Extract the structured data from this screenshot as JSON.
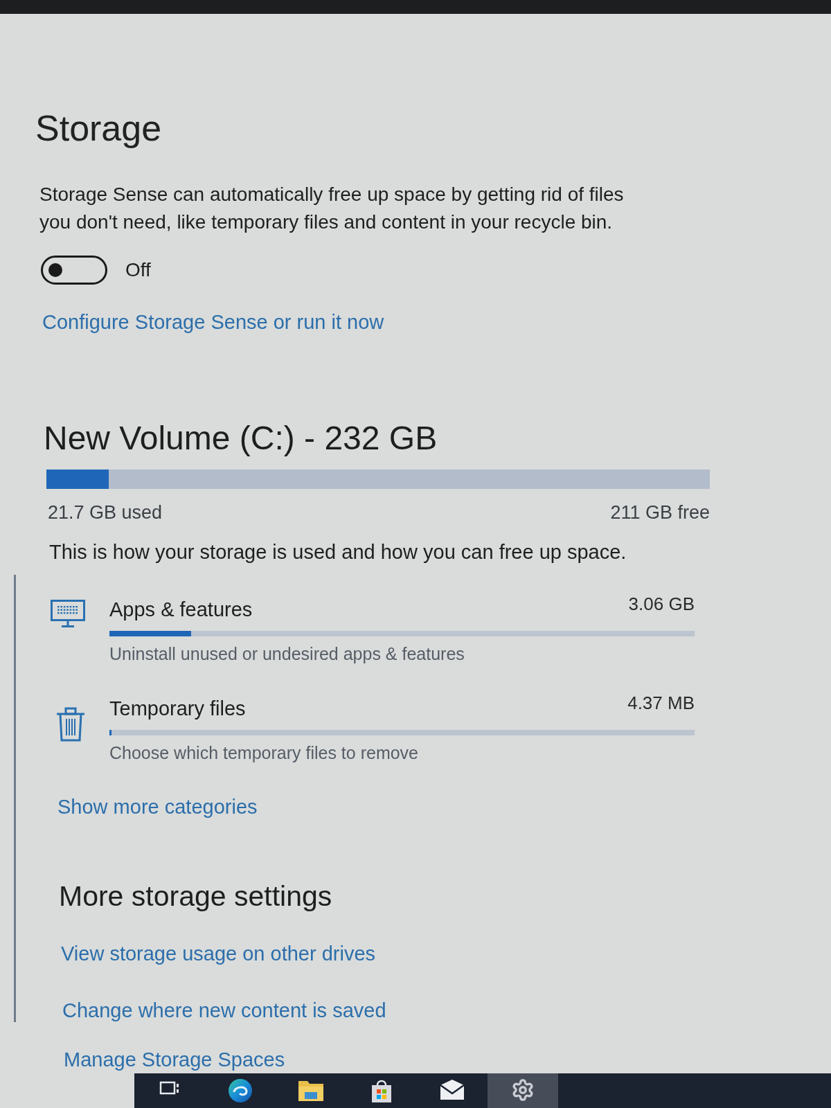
{
  "page": {
    "title": "Storage"
  },
  "storage_sense": {
    "description": "Storage Sense can automatically free up space by getting rid of files you don't need, like temporary files and content in your recycle bin.",
    "toggle": {
      "on": false,
      "label": "Off"
    },
    "link": "Configure Storage Sense or run it now"
  },
  "volume": {
    "title": "New Volume (C:) - 232 GB",
    "level": 0.094,
    "used": "21.7 GB used",
    "free": "211 GB free",
    "summary": "This is how your storage is used and how you can free up space.",
    "categories": [
      {
        "kind": "apps",
        "name": "Apps & features",
        "size": "3.06 GB",
        "level": 0.14,
        "description": "Uninstall unused or undesired apps & features"
      },
      {
        "kind": "temp",
        "name": "Temporary files",
        "size": "4.37 MB",
        "level": 0.004,
        "description": "Choose which temporary files to remove"
      }
    ],
    "show_more": "Show more categories"
  },
  "more_settings": {
    "title": "More storage settings",
    "links": [
      "View storage usage on other drives",
      "Change where new content is saved",
      "Manage Storage Spaces"
    ]
  },
  "taskbar": {
    "items": [
      {
        "kind": "task_view",
        "selected": false
      },
      {
        "kind": "browser",
        "selected": false
      },
      {
        "kind": "folder",
        "selected": false
      },
      {
        "kind": "store",
        "selected": false
      },
      {
        "kind": "mail",
        "selected": false
      },
      {
        "kind": "settings",
        "selected": true
      }
    ]
  }
}
